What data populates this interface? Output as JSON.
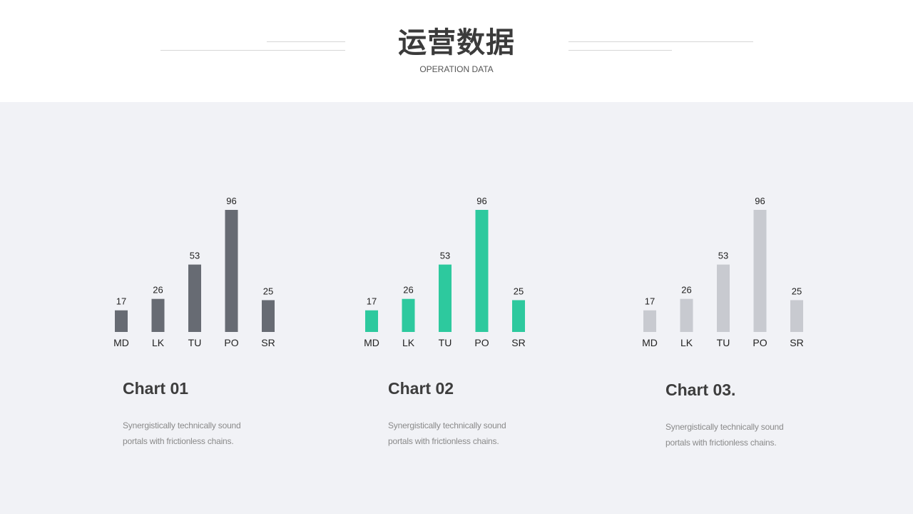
{
  "header": {
    "title": "运营数据",
    "subtitle": "OPERATION DATA"
  },
  "colors": {
    "chart1": "#676b73",
    "chart2": "#2dc99e",
    "chart3": "#c8cad0",
    "background": "#f1f2f6"
  },
  "chart_data": [
    {
      "type": "bar",
      "categories": [
        "MD",
        "LK",
        "TU",
        "PO",
        "SR"
      ],
      "values": [
        17,
        26,
        53,
        96,
        25
      ],
      "title": "Chart 01",
      "ylim": [
        0,
        96
      ]
    },
    {
      "type": "bar",
      "categories": [
        "MD",
        "LK",
        "TU",
        "PO",
        "SR"
      ],
      "values": [
        17,
        26,
        53,
        96,
        25
      ],
      "title": "Chart 02",
      "ylim": [
        0,
        96
      ]
    },
    {
      "type": "bar",
      "categories": [
        "MD",
        "LK",
        "TU",
        "PO",
        "SR"
      ],
      "values": [
        17,
        26,
        53,
        96,
        25
      ],
      "title": "Chart 03.",
      "ylim": [
        0,
        96
      ]
    }
  ],
  "descriptions": [
    {
      "line1": "Synergistically technically sound",
      "line2": "portals with frictionless chains."
    },
    {
      "line1": "Synergistically technically sound",
      "line2": "portals with frictionless chains."
    },
    {
      "line1": "Synergistically technically sound",
      "line2": "portals with frictionless chains."
    }
  ]
}
